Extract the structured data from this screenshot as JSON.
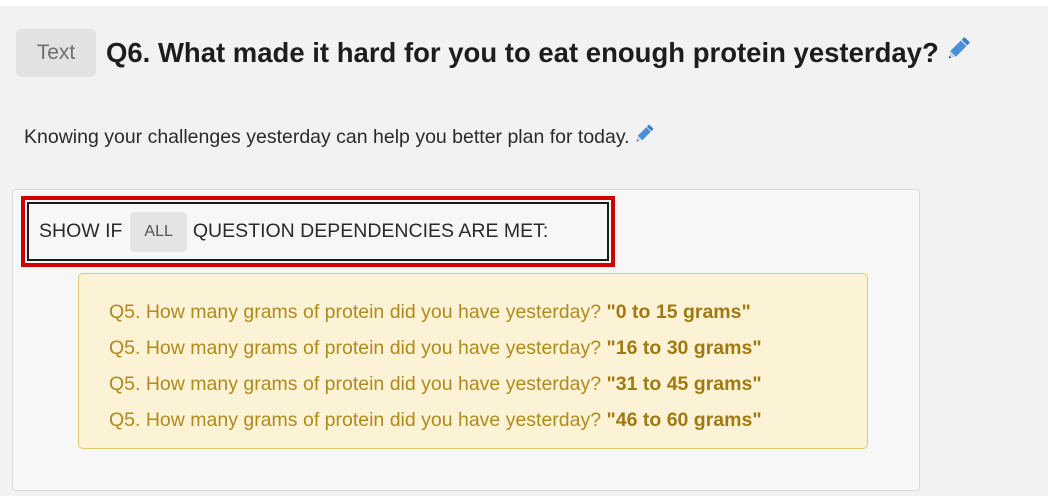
{
  "question": {
    "type_badge": "Text",
    "title": "Q6. What made it hard for you to eat enough protein yesterday?",
    "edit_icon": "pencil-icon",
    "description": "Knowing your challenges yesterday can help you better plan for today."
  },
  "logic": {
    "show_if_prefix": "SHOW IF",
    "match_mode": "ALL",
    "show_if_suffix": "QUESTION DEPENDENCIES ARE MET:",
    "highlight_color": "#d10000",
    "dependencies": [
      {
        "question": "Q5. How many grams of protein did you have yesterday?",
        "answer": "\"0 to 15 grams\""
      },
      {
        "question": "Q5. How many grams of protein did you have yesterday?",
        "answer": "\"16 to 30 grams\""
      },
      {
        "question": "Q5. How many grams of protein did you have yesterday?",
        "answer": "\"31 to 45 grams\""
      },
      {
        "question": "Q5. How many grams of protein did you have yesterday?",
        "answer": "\"46 to 60 grams\""
      }
    ]
  },
  "colors": {
    "dependency_text": "#b08a1a",
    "dependency_background": "#fcf3d6",
    "pencil": "#4a90d9"
  }
}
